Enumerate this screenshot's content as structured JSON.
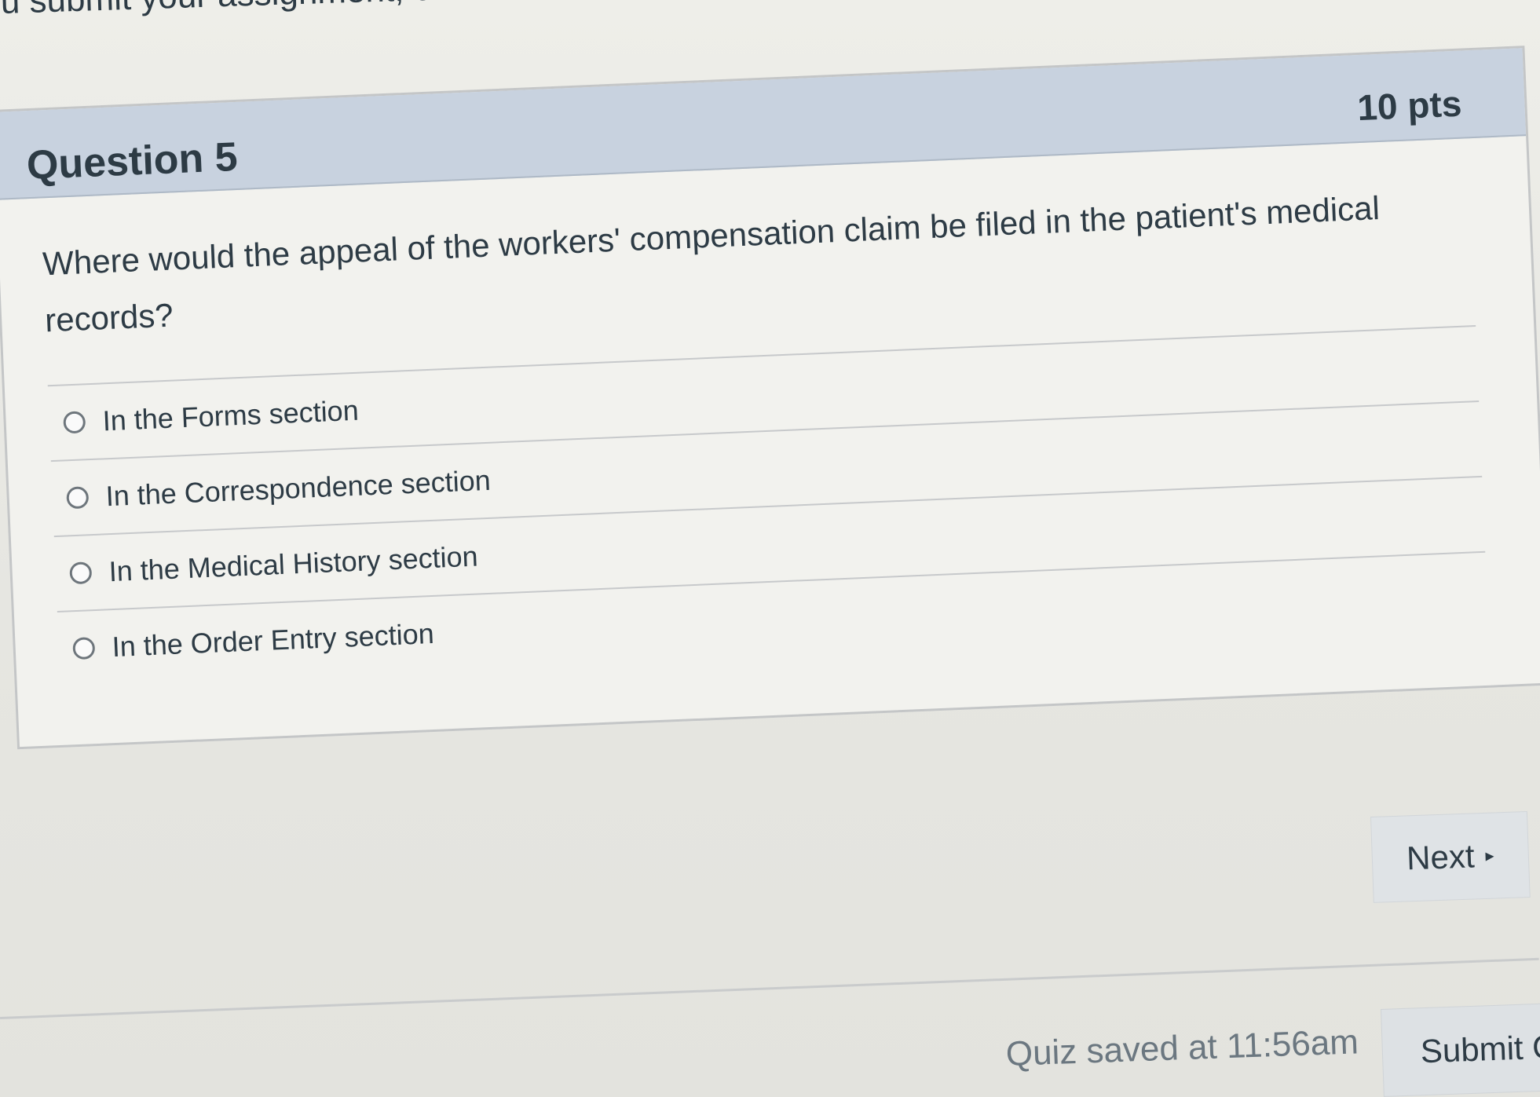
{
  "instructions": {
    "text": "u submit your assignment, click "
  },
  "question": {
    "title": "Question 5",
    "points": "10 pts",
    "text": "Where would the appeal of the workers' compensation claim be filed in the patient's medical records?",
    "answers": [
      {
        "label": "In the Forms section"
      },
      {
        "label": "In the Correspondence section"
      },
      {
        "label": "In the Medical History section"
      },
      {
        "label": "In the Order Entry section"
      }
    ]
  },
  "navigation": {
    "next_label": "Next",
    "next_icon": "triangle-right-icon"
  },
  "footer": {
    "saved_text": "Quiz saved at 11:56am",
    "submit_label": "Submit Quiz"
  },
  "colors": {
    "header_background": "#c8d2df",
    "text": "#2d3b45",
    "page_background": "#e9e9e4"
  }
}
